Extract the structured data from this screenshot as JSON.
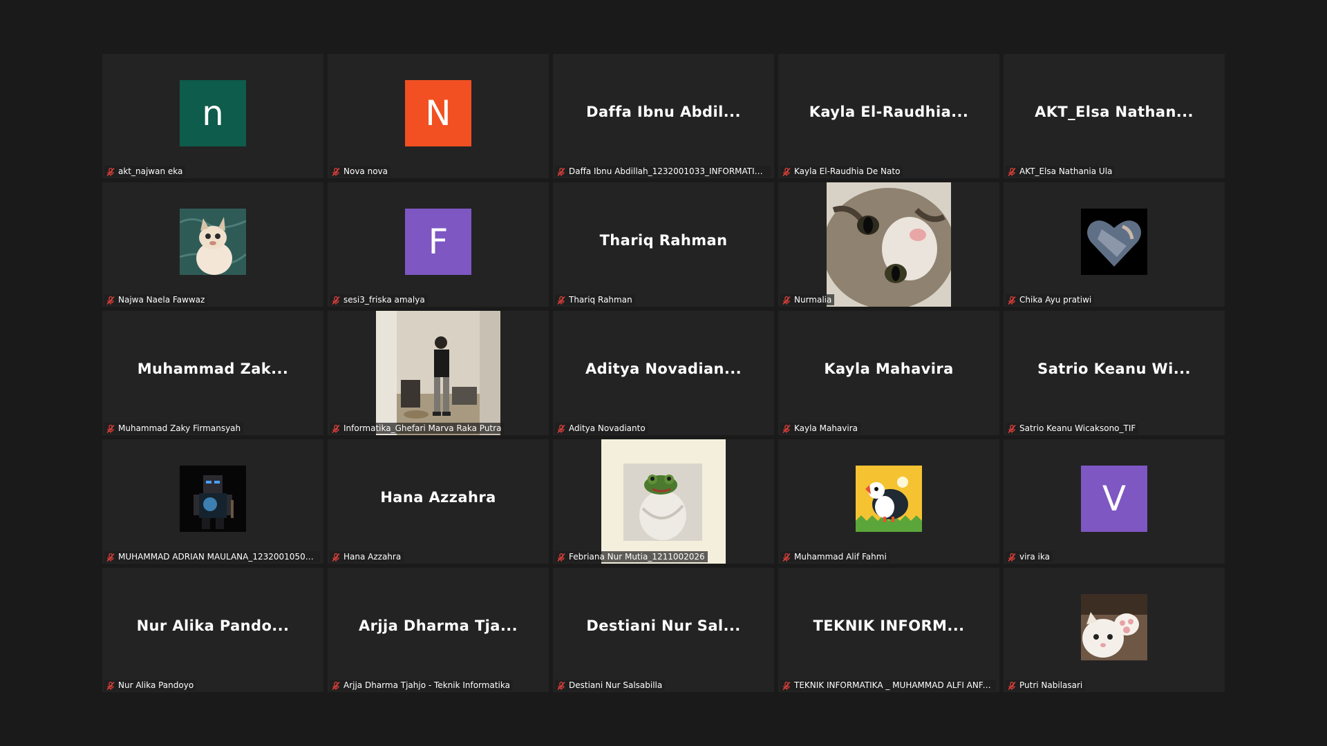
{
  "tiles": [
    {
      "name": "akt_najwan eka",
      "display": "letter",
      "letter": "n",
      "color": "#0e5c4b",
      "icon": "muted-mic-icon"
    },
    {
      "name": "Nova nova",
      "display": "letter",
      "letter": "N",
      "color": "#f25022",
      "icon": "muted-mic-icon"
    },
    {
      "name": "Daffa Ibnu Abdillah_1232001033_INFORMATIKA_...",
      "display": "text",
      "big": "Daffa  Ibnu  Abdil...",
      "icon": "muted-mic-icon"
    },
    {
      "name": "Kayla El-Raudhia De Nato",
      "display": "text",
      "big": "Kayla  El-Raudhia...",
      "icon": "muted-mic-icon"
    },
    {
      "name": "AKT_Elsa Nathania Ula",
      "display": "text",
      "big": "AKT_Elsa  Nathan...",
      "icon": "muted-mic-icon"
    },
    {
      "name": "Najwa Naela Fawwaz",
      "display": "pic",
      "pic": "siamese-cat-drawing",
      "icon": "muted-mic-icon"
    },
    {
      "name": "sesi3_friska amalya",
      "display": "letter",
      "letter": "F",
      "color": "#7e57c2",
      "icon": "muted-mic-icon"
    },
    {
      "name": "Thariq Rahman",
      "display": "text",
      "big": "Thariq Rahman",
      "icon": "muted-mic-icon"
    },
    {
      "name": "Nurmalia",
      "display": "video",
      "pic": "cat-closeup-photo",
      "icon": "muted-mic-icon"
    },
    {
      "name": "Chika Ayu pratiwi",
      "display": "pic",
      "pic": "heart-photo",
      "icon": "muted-mic-icon"
    },
    {
      "name": "Muhammad Zaky Firmansyah",
      "display": "text",
      "big": "Muhammad  Zak...",
      "icon": "muted-mic-icon"
    },
    {
      "name": "Informatika_Ghefari Marva Raka Putra",
      "display": "video",
      "pic": "person-in-room-video",
      "icon": "muted-mic-icon"
    },
    {
      "name": "Aditya Novadianto",
      "display": "text",
      "big": "Aditya  Novadian...",
      "icon": "muted-mic-icon"
    },
    {
      "name": "Kayla Mahavira",
      "display": "text",
      "big": "Kayla Mahavira",
      "icon": "muted-mic-icon"
    },
    {
      "name": "Satrio Keanu Wicaksono_TIF",
      "display": "text",
      "big": "Satrio  Keanu  Wi...",
      "icon": "muted-mic-icon"
    },
    {
      "name": "MUHAMMAD ADRIAN MAULANA_1232001050_TI...",
      "display": "pic",
      "pic": "dark-character-art",
      "icon": "muted-mic-icon"
    },
    {
      "name": "Hana Azzahra",
      "display": "text",
      "big": "Hana Azzahra",
      "icon": "muted-mic-icon"
    },
    {
      "name": "Febriana Nur Mutia_1211002026",
      "display": "video",
      "pic": "green-frog-toy-photo",
      "icon": "muted-mic-icon"
    },
    {
      "name": "Muhammad Alif Fahmi",
      "display": "pic",
      "pic": "puffin-illustration",
      "icon": "muted-mic-icon"
    },
    {
      "name": "vira ika",
      "display": "letter",
      "letter": "V",
      "color": "#7e57c2",
      "icon": "muted-mic-icon"
    },
    {
      "name": "Nur Alika Pandoyo",
      "display": "text",
      "big": "Nur  Alika  Pando...",
      "icon": "muted-mic-icon"
    },
    {
      "name": "Arjja Dharma Tjahjo - Teknik Informatika",
      "display": "text",
      "big": "Arjja  Dharma  Tja...",
      "icon": "muted-mic-icon"
    },
    {
      "name": "Destiani Nur Salsabilla",
      "display": "text",
      "big": "Destiani  Nur  Sal...",
      "icon": "muted-mic-icon"
    },
    {
      "name": "TEKNIK INFORMATIKA _ MUHAMMAD ALFI ANFA...",
      "display": "text",
      "big": "TEKNIK  INFORM...",
      "icon": "muted-mic-icon"
    },
    {
      "name": "Putri Nabilasari",
      "display": "pic",
      "pic": "kitten-paw-photo",
      "icon": "muted-mic-icon"
    }
  ]
}
